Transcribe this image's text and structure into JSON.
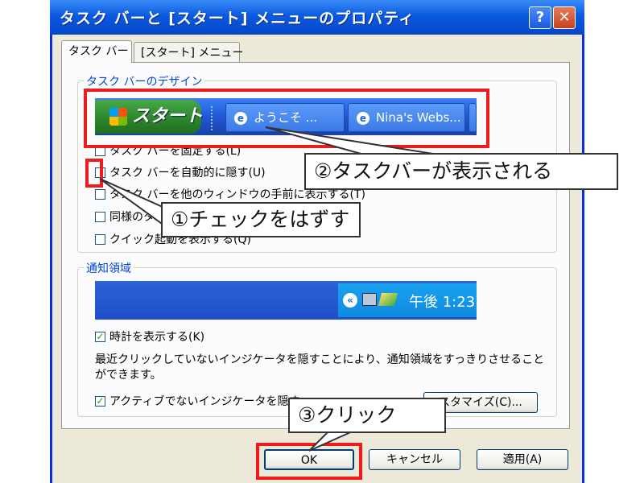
{
  "window": {
    "title": "タスク バーと [スタート] メニューのプロパティ",
    "help_label": "?",
    "close_label": "✕"
  },
  "tabs": [
    {
      "label": "タスク バー",
      "selected": true
    },
    {
      "label": "[スタート] メニュー",
      "selected": false
    }
  ],
  "taskbar_group": {
    "label": "タスク バーのデザイン",
    "preview": {
      "start_label": "スタート",
      "buttons": [
        {
          "icon": "ie-icon",
          "label": "ようこそ ..."
        },
        {
          "icon": "ie-icon",
          "label": "Nina's Webs..."
        }
      ]
    },
    "options": [
      {
        "label": "タスク バーを固定する(L)",
        "checked": false
      },
      {
        "label": "タスク バーを自動的に隠す(U)",
        "checked": false
      },
      {
        "label": "タスク バーを他のウィンドウの手前に表示する(T)",
        "checked": false
      },
      {
        "label": "同様のタ",
        "checked": false
      },
      {
        "label": "クイック起動を表示する(Q)",
        "checked": false
      }
    ]
  },
  "notify_group": {
    "label": "通知領域",
    "clock": "午後 1:23",
    "show_clock_label": "時計を表示する(K)",
    "show_clock_checked": true,
    "description": "最近クリックしていないインジケータを隠すことにより、通知領域をすっきりさせることができます。",
    "hide_inactive_label": "アクティブでないインジケータを隠す",
    "hide_inactive_checked": true,
    "customize_label": "スタマイズ(C)..."
  },
  "footer": {
    "ok_label": "OK",
    "cancel_label": "キャンセル",
    "apply_label": "適用(A)"
  },
  "annotations": {
    "callout_1": "①チェックをはずす",
    "callout_2": "②タスクバーが表示される",
    "callout_3": "③クリック"
  },
  "colors": {
    "titlebar": "#0a5ae0",
    "group_label": "#0046d5",
    "annotation_red": "#ee1c1c",
    "start_green": "#2f8a2f",
    "taskbar_blue": "#245edb"
  }
}
